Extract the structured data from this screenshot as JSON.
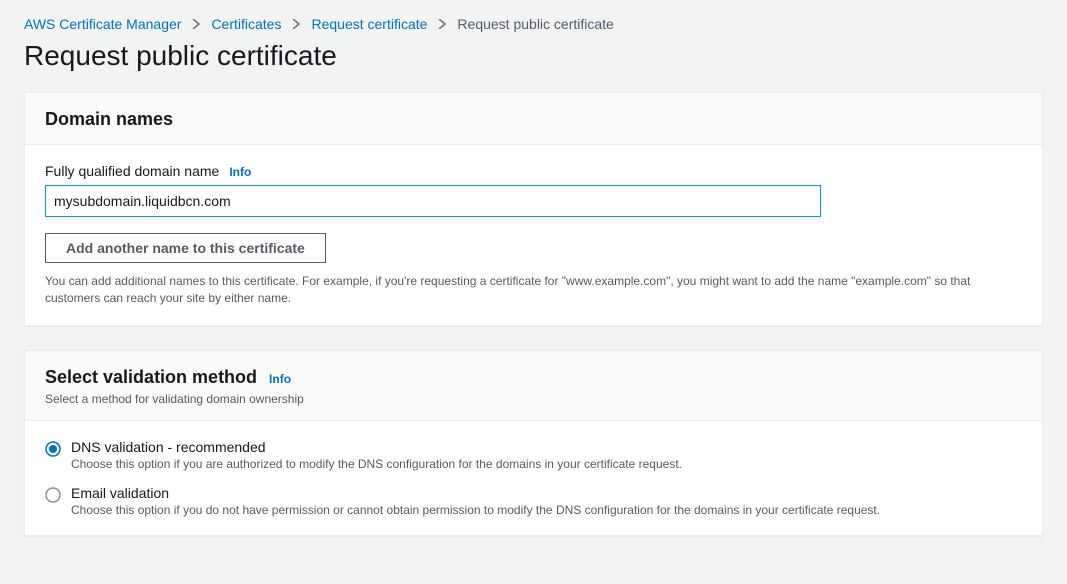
{
  "breadcrumbs": {
    "items": [
      "AWS Certificate Manager",
      "Certificates",
      "Request certificate",
      "Request public certificate"
    ]
  },
  "page_title": "Request public certificate",
  "info_label": "Info",
  "domain_panel": {
    "title": "Domain names",
    "field_label": "Fully qualified domain name",
    "input_value": "mysubdomain.liquidbcn.com",
    "add_button": "Add another name to this certificate",
    "help": "You can add additional names to this certificate. For example, if you're requesting a certificate for \"www.example.com\", you might want to add the name \"example.com\" so that customers can reach your site by either name."
  },
  "validation_panel": {
    "title": "Select validation method",
    "subtext": "Select a method for validating domain ownership",
    "options": [
      {
        "label": "DNS validation - recommended",
        "desc": "Choose this option if you are authorized to modify the DNS configuration for the domains in your certificate request."
      },
      {
        "label": "Email validation",
        "desc": "Choose this option if you do not have permission or cannot obtain permission to modify the DNS configuration for the domains in your certificate request."
      }
    ]
  }
}
